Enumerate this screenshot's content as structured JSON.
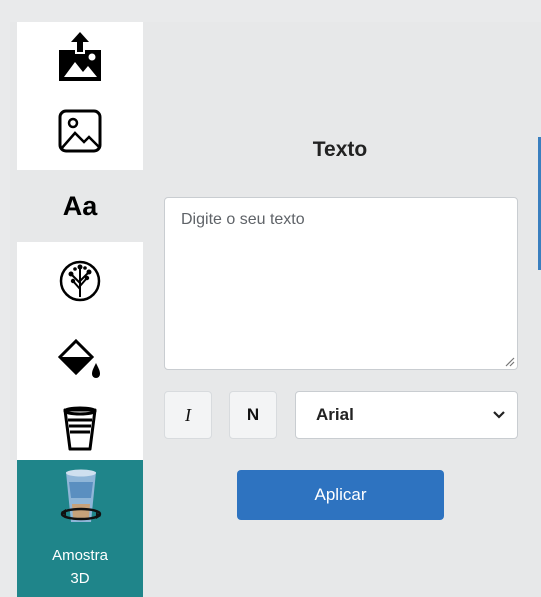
{
  "sidebar": {
    "items": [
      {
        "icon": "image-upload-icon"
      },
      {
        "icon": "image-icon"
      },
      {
        "icon": "text-icon",
        "label": "Aa",
        "active": true
      },
      {
        "icon": "tree-pattern-icon"
      },
      {
        "icon": "paint-bucket-icon"
      },
      {
        "icon": "cup-icon"
      }
    ],
    "sample": {
      "icon": "cup-3d-icon",
      "label_line1": "Amostra",
      "label_line2": "3D"
    }
  },
  "panel": {
    "title": "Texto",
    "text_input": {
      "value": "",
      "placeholder": "Digite o seu texto"
    },
    "italic_label": "I",
    "normal_label": "N",
    "font_select": {
      "selected": "Arial"
    },
    "apply_label": "Aplicar"
  },
  "colors": {
    "accent": "#2e73c0",
    "sample_bg": "#1f858a",
    "active_bg": "#e7e8e9"
  }
}
